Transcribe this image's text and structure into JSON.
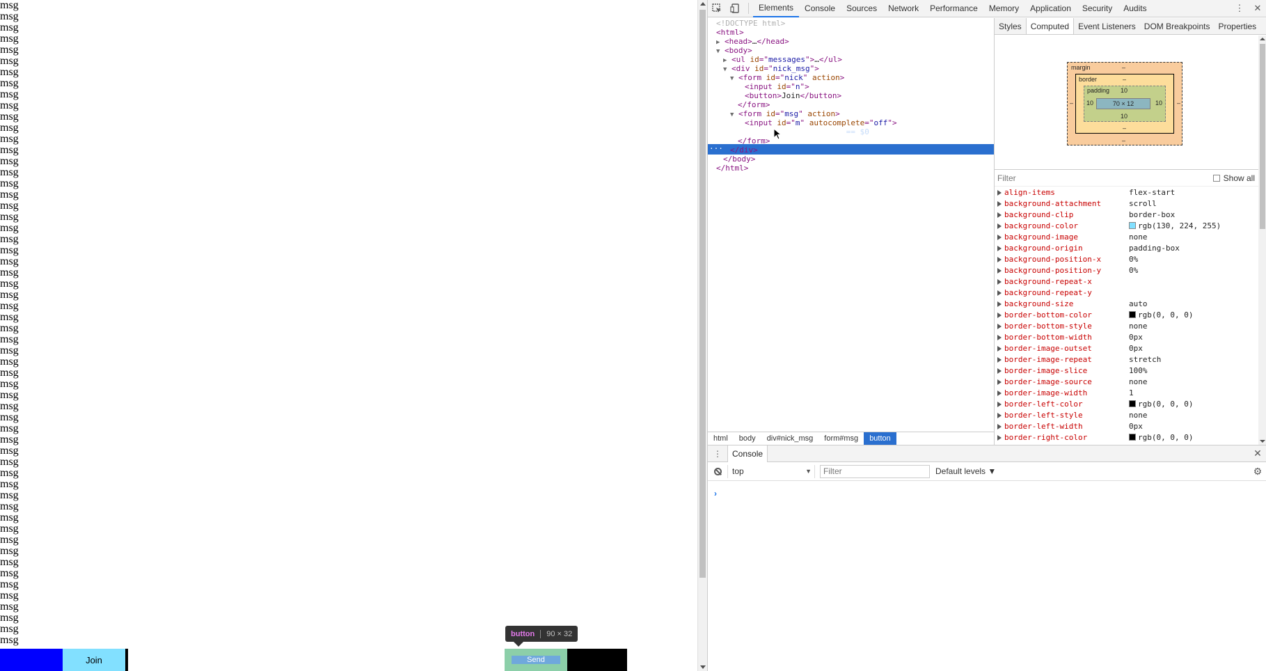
{
  "page": {
    "message_text": "msg",
    "message_count": 58,
    "join_label": "Join",
    "send_label": "Send",
    "tooltip": {
      "tag": "button",
      "dims": "90 × 32"
    },
    "colors": {
      "nick_input": "#0000ff",
      "join_button": "#82e0ff",
      "send_margin": "#8ccfa9",
      "send_content": "#6fa8dc"
    }
  },
  "devtools": {
    "toolbar": {
      "inspect_icon": "inspect-element-icon",
      "device_icon": "device-toolbar-icon",
      "tabs": [
        "Elements",
        "Console",
        "Sources",
        "Network",
        "Performance",
        "Memory",
        "Application",
        "Security",
        "Audits"
      ],
      "active_tab": "Elements",
      "menu_icon": "kebab-menu-icon",
      "close_icon": "close-icon"
    },
    "dom": {
      "doctype": "<!DOCTYPE html>",
      "html_open": "html",
      "head": "head",
      "ellipsis": "…",
      "body": "body",
      "ul_tag": "ul",
      "ul_attr": "id",
      "ul_val": "messages",
      "div_tag": "div",
      "div_attr": "id",
      "div_val": "nick_msg",
      "form1_tag": "form",
      "form1_attr": "id",
      "form1_val": "nick",
      "form_action": "action",
      "input1_tag": "input",
      "input1_attr": "id",
      "input1_val": "n",
      "button1_tag": "button",
      "button1_text": "Join",
      "form2_val": "msg",
      "input2_val": "m",
      "autocomplete_attr": "autocomplete",
      "autocomplete_val": "off",
      "button2_text": "Send",
      "selected_suffix": "== $0"
    },
    "breadcrumbs": [
      "html",
      "body",
      "div#nick_msg",
      "form#msg",
      "button"
    ],
    "side_tabs": [
      "Styles",
      "Computed",
      "Event Listeners",
      "DOM Breakpoints",
      "Properties"
    ],
    "active_side_tab": "Computed",
    "box_model": {
      "margin_label": "margin",
      "border_label": "border",
      "padding_label": "padding",
      "dash": "–",
      "padding_value": "10",
      "content": "70 × 12"
    },
    "filter_placeholder": "Filter",
    "show_all_label": "Show all",
    "computed": [
      {
        "name": "align-items",
        "value": "flex-start"
      },
      {
        "name": "background-attachment",
        "value": "scroll"
      },
      {
        "name": "background-clip",
        "value": "border-box"
      },
      {
        "name": "background-color",
        "value": "rgb(130, 224, 255)",
        "swatch": "#82e0ff"
      },
      {
        "name": "background-image",
        "value": "none"
      },
      {
        "name": "background-origin",
        "value": "padding-box"
      },
      {
        "name": "background-position-x",
        "value": "0%"
      },
      {
        "name": "background-position-y",
        "value": "0%"
      },
      {
        "name": "background-repeat-x",
        "value": ""
      },
      {
        "name": "background-repeat-y",
        "value": ""
      },
      {
        "name": "background-size",
        "value": "auto"
      },
      {
        "name": "border-bottom-color",
        "value": "rgb(0, 0, 0)",
        "swatch": "#000000"
      },
      {
        "name": "border-bottom-style",
        "value": "none"
      },
      {
        "name": "border-bottom-width",
        "value": "0px"
      },
      {
        "name": "border-image-outset",
        "value": "0px"
      },
      {
        "name": "border-image-repeat",
        "value": "stretch"
      },
      {
        "name": "border-image-slice",
        "value": "100%"
      },
      {
        "name": "border-image-source",
        "value": "none"
      },
      {
        "name": "border-image-width",
        "value": "1"
      },
      {
        "name": "border-left-color",
        "value": "rgb(0, 0, 0)",
        "swatch": "#000000"
      },
      {
        "name": "border-left-style",
        "value": "none"
      },
      {
        "name": "border-left-width",
        "value": "0px"
      },
      {
        "name": "border-right-color",
        "value": "rgb(0, 0, 0)",
        "swatch": "#000000"
      }
    ],
    "console": {
      "tab_label": "Console",
      "context": "top",
      "filter_placeholder": "Filter",
      "levels": "Default levels ▼",
      "prompt": "›"
    }
  }
}
